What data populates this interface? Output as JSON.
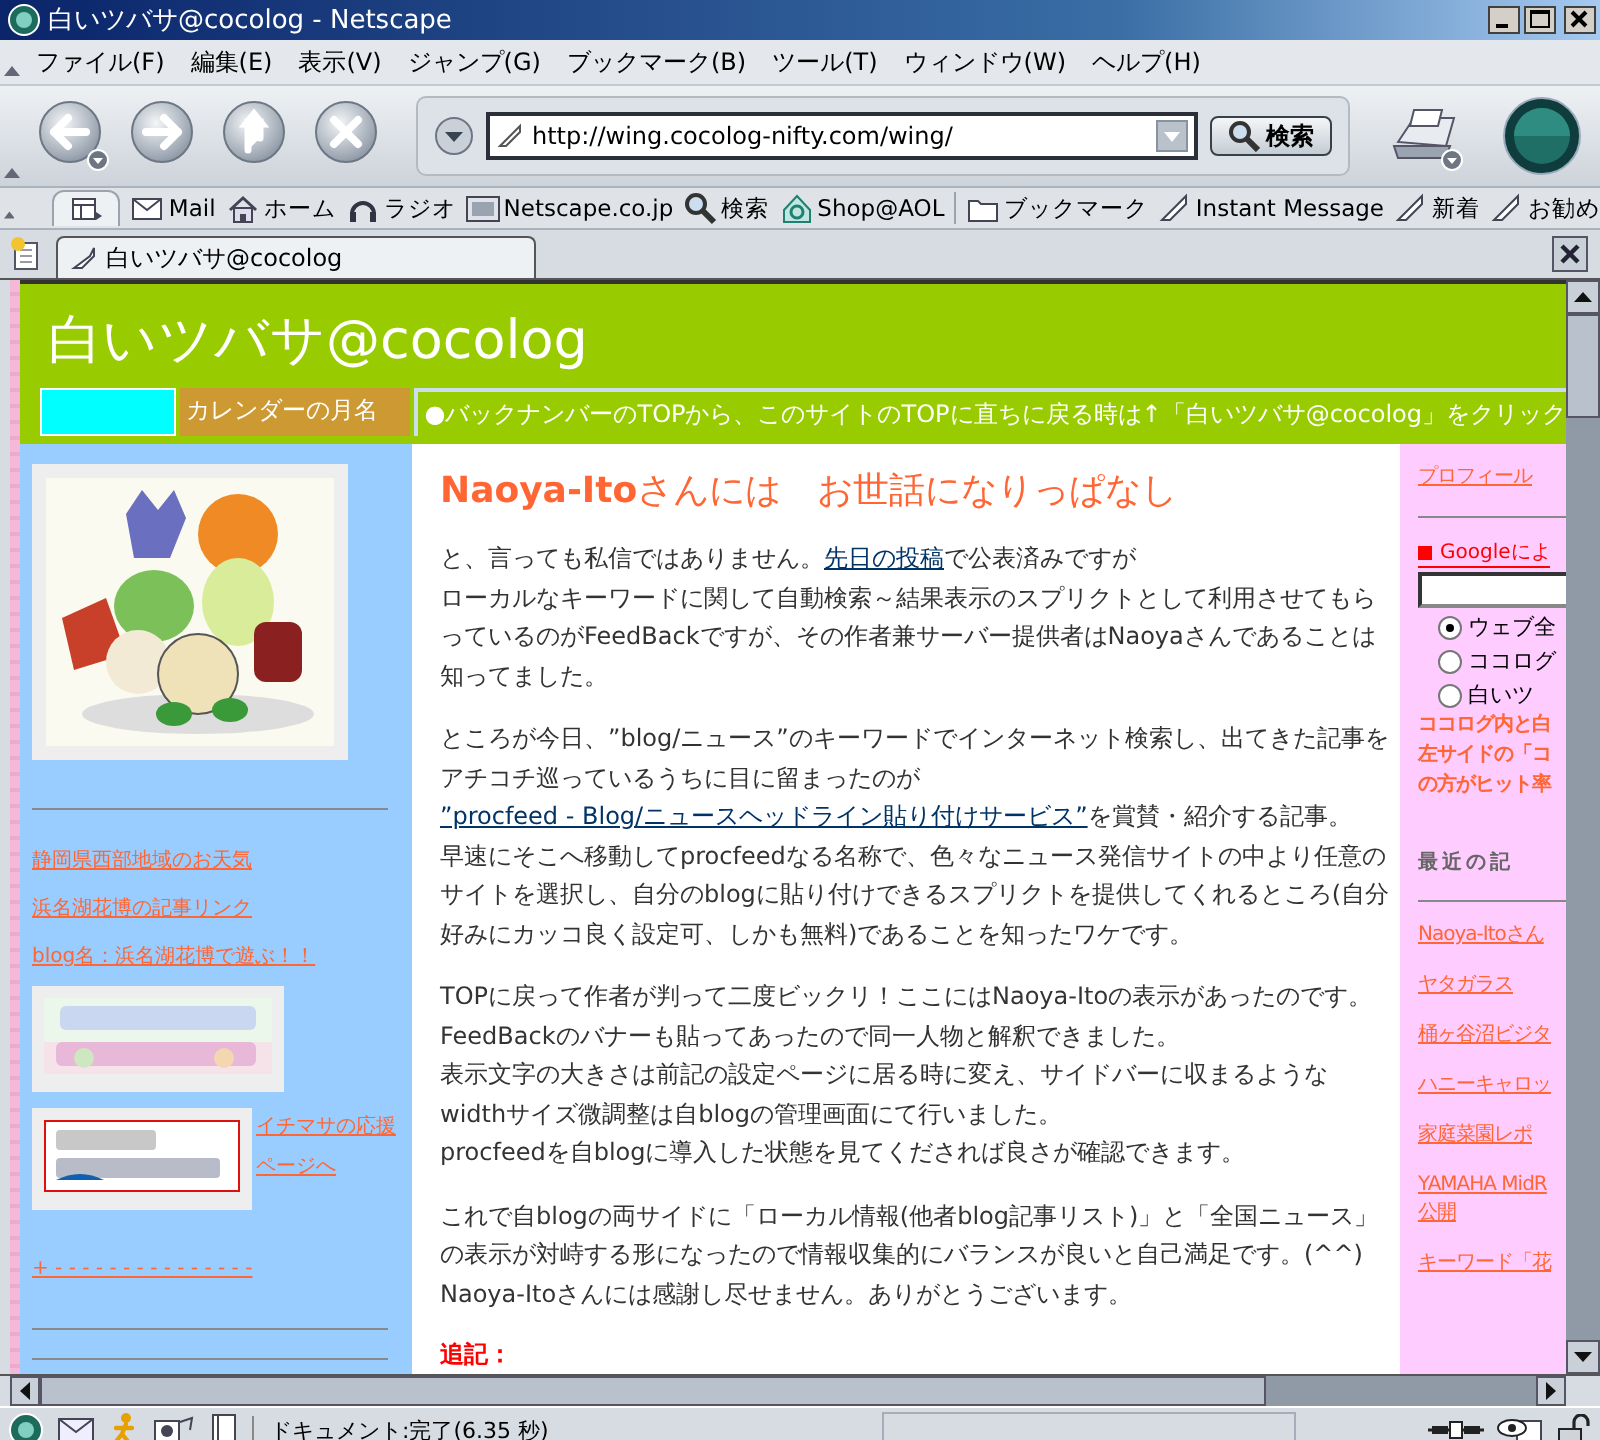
{
  "window": {
    "title": "白いツバサ@cocolog - Netscape"
  },
  "menu": [
    "ファイル(F)",
    "編集(E)",
    "表示(V)",
    "ジャンプ(G)",
    "ブックマーク(B)",
    "ツール(T)",
    "ウィンドウ(W)",
    "ヘルプ(H)"
  ],
  "address": {
    "value": "http://wing.cocolog-nifty.com/wing/"
  },
  "search_button": "検索",
  "personal_toolbar": [
    {
      "kind": "mail",
      "label": "Mail"
    },
    {
      "kind": "home",
      "label": "ホーム"
    },
    {
      "kind": "radio",
      "label": "ラジオ"
    },
    {
      "kind": "my",
      "label": "Netscape.co.jp"
    },
    {
      "kind": "search",
      "label": "検索"
    },
    {
      "kind": "shop",
      "label": "Shop@AOL"
    },
    {
      "kind": "folder",
      "label": "ブックマーク"
    },
    {
      "kind": "bookmark",
      "label": "Instant Message"
    },
    {
      "kind": "bookmark",
      "label": "新着"
    },
    {
      "kind": "bookmark",
      "label": "お勧め"
    }
  ],
  "tabs": [
    {
      "label": "白いツバサ@cocolog",
      "selected": true
    }
  ],
  "page": {
    "site_title": "白いツバサ@cocolog",
    "calendar_label": "カレンダーの月名",
    "notice": "●バックナンバーのTOPから、このサイトのTOPに直ちに戻る時は↑「白いツバサ@cocolog」をクリック",
    "left_sidebar": {
      "links": [
        "静岡県西部地域のお天気",
        "浜名湖花博の記事リンク",
        "blog名：浜名湖花博で遊ぶ！！"
      ],
      "banner_link": "イチマサの応援ページへ",
      "dash_link": "+ - - - - - - - - - - - - - - -"
    },
    "article": {
      "title": "**Naoya-Ito**さんには　お世話になりっぱなし",
      "paragraphs": [
        {
          "lines": [
            [
              {
                "text": "と、言っても私信ではありません。"
              },
              {
                "text": "先日の投稿",
                "link": true
              },
              {
                "text": "で公表済みですが"
              }
            ],
            [
              {
                "text": "ローカルなキーワードに関して自動検索～結果表示のスプリクトとして利用させてもらっているのがFeedBackですが、その作者兼サーバー提供者はNaoyaさんであることは知ってました。"
              }
            ]
          ]
        },
        {
          "lines": [
            [
              {
                "text": "ところが今日、”blog/ニュース”のキーワードでインターネット検索し、出てきた記事をアチコチ巡っているうちに目に留まったのが "
              },
              {
                "text": "”procfeed - Blog/ニュースヘッドライン貼り付けサービス”",
                "link": true
              },
              {
                "text": "を賞賛・紹介する記事。"
              }
            ],
            [
              {
                "text": "早速にそこへ移動してprocfeedなる名称で、色々なニュース発信サイトの中より任意のサイトを選択し、自分のblogに貼り付けできるスプリクトを提供してくれるところ(自分好みにカッコ良く設定可、しかも無料)であることを知ったワケです。"
              }
            ]
          ]
        },
        {
          "lines": [
            [
              {
                "text": "TOPに戻って作者が判って二度ビックリ！ここにはNaoya-Itoの表示があったのです。"
              }
            ],
            [
              {
                "text": "FeedBackのバナーも貼ってあったので同一人物と解釈できました。"
              }
            ],
            [
              {
                "text": "表示文字の大きさは前記の設定ページに居る時に変え、サイドバーに収まるような"
              }
            ],
            [
              {
                "text": "widthサイズ微調整は自blogの管理画面にて行いました。"
              }
            ],
            [
              {
                "text": "procfeedを自blogに導入した状態を見てくだされば良さが確認できます。"
              }
            ]
          ]
        },
        {
          "lines": [
            [
              {
                "text": "これで自blogの両サイドに「ローカル情報(他者blog記事リスト)」と「全国ニュース」の表示が対峙する形になったので情報収集的にバランスが良いと自己満足です。(^^)"
              }
            ],
            [
              {
                "text": "Naoya-Itoさんには感謝し尽せません。ありがとうございます。"
              }
            ]
          ]
        }
      ],
      "postscript": "追記："
    },
    "right_sidebar": {
      "profile_link": "プロフィール",
      "search_heading": "Googleによ",
      "search_options": [
        {
          "label": "ウェブ全",
          "selected": true
        },
        {
          "label": "ココログ",
          "selected": false
        },
        {
          "label": "白いツ",
          "selected": false
        }
      ],
      "note_lines": [
        "ココログ内と白",
        "左サイドの「コ",
        "の方がヒット率"
      ],
      "recent_heading": "最近の記",
      "recent": [
        {
          "lines": [
            "Naoya-Itoさん"
          ]
        },
        {
          "lines": [
            "ヤタガラス"
          ]
        },
        {
          "lines": [
            "桶ヶ谷沼ビジタ"
          ]
        },
        {
          "lines": [
            "ハニーキャロッ"
          ]
        },
        {
          "lines": [
            "家庭菜園レポ"
          ]
        },
        {
          "lines": [
            "YAMAHA MidR",
            "公開"
          ]
        },
        {
          "lines": [
            "キーワード「花"
          ]
        }
      ]
    }
  },
  "status_bar": {
    "text": "ドキュメント:完了(6.35 秒)"
  }
}
